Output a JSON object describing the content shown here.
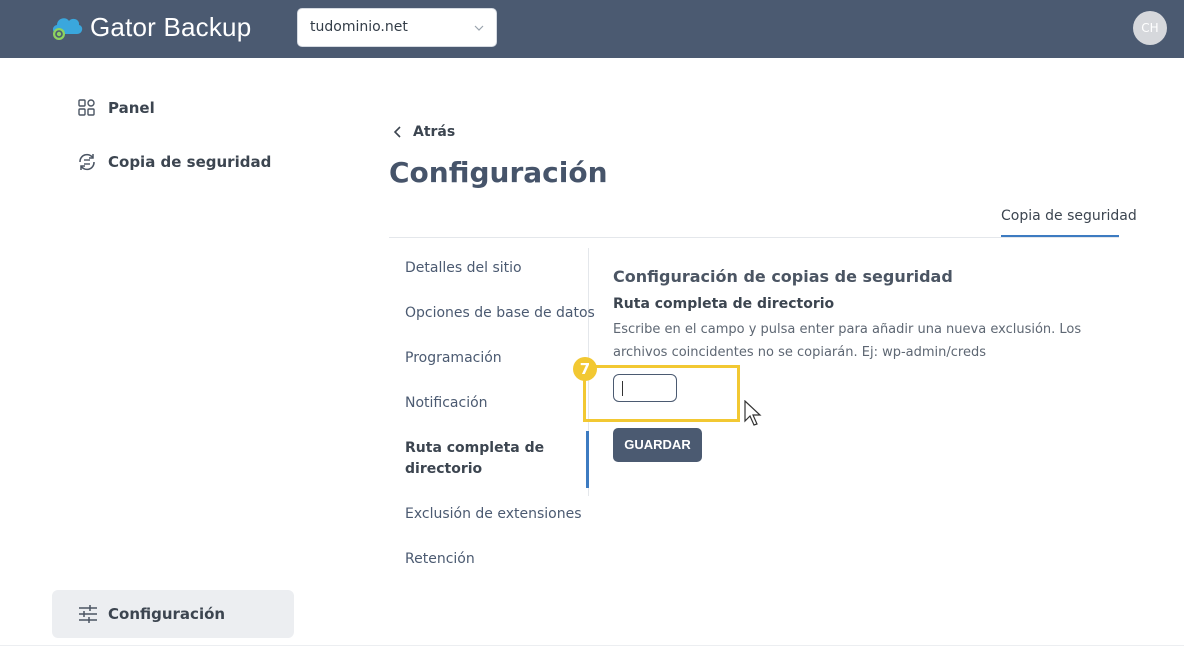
{
  "header": {
    "brand": "Gator Backup",
    "domain_value": "tudominio.net",
    "avatar_initials": "CH",
    "colors": {
      "bar": "#4b5a71",
      "logo_cloud": "#3aa7dd",
      "logo_accent": "#8dd35f"
    }
  },
  "sidebar": {
    "items": [
      {
        "label": "Panel",
        "icon": "panel-grid-icon"
      },
      {
        "label": "Copia de seguridad",
        "icon": "backup-sync-icon"
      }
    ],
    "active": {
      "label": "Configuración",
      "icon": "sliders-icon"
    }
  },
  "main": {
    "back_label": "Atrás",
    "title": "Configuración",
    "tabs": [
      {
        "label": "Copia de seguridad",
        "active": true
      }
    ],
    "subnav": [
      {
        "label": "Detalles del sitio"
      },
      {
        "label": "Opciones de base de datos"
      },
      {
        "label": "Programación"
      },
      {
        "label": "Notificación"
      },
      {
        "label": "Ruta completa de directorio",
        "active": true
      },
      {
        "label": "Exclusión de extensiones"
      },
      {
        "label": "Retención"
      }
    ],
    "section_title": "Configuración de copias de seguridad",
    "field_label": "Ruta completa de directorio",
    "help_text": "Escribe en el campo y pulsa enter para añadir una nueva exclusión. Los archivos coincidentes no se copiarán. Ej: wp-admin/creds",
    "input_value": "",
    "save_label": "GUARDAR",
    "step_badge": "7",
    "accent_color": "#3d7bc1",
    "highlight_color": "#f2c832"
  }
}
